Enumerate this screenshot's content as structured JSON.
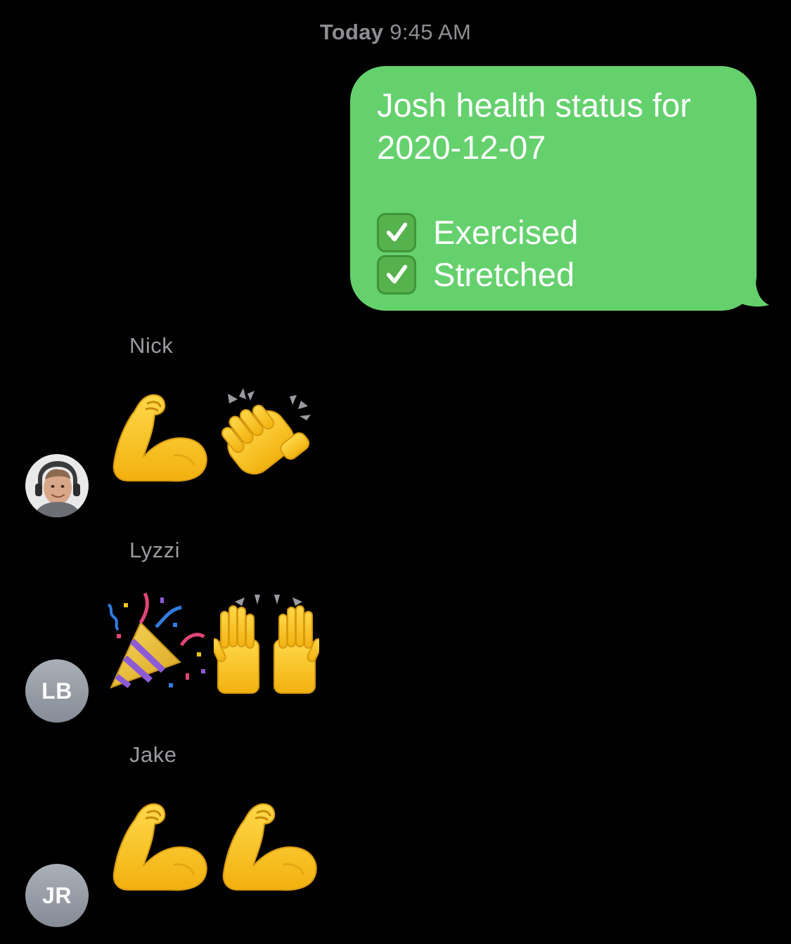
{
  "header": {
    "timestamp_day": "Today",
    "timestamp_time": "9:45 AM"
  },
  "colors": {
    "background": "#000000",
    "outgoing_bubble": "#65d16d",
    "sender_name": "#9a9aa0",
    "timestamp": "#8e8e93"
  },
  "outgoing_message": {
    "line1": "Josh health status for",
    "line2": "2020-12-07",
    "items": [
      {
        "icon": "check-mark-button-emoji",
        "label": "Exercised"
      },
      {
        "icon": "check-mark-button-emoji",
        "label": "Stretched"
      }
    ]
  },
  "incoming_messages": [
    {
      "sender": "Nick",
      "avatar_type": "photo",
      "avatar_initials": "",
      "emojis": [
        "flexed-biceps-emoji",
        "clapping-hands-emoji"
      ]
    },
    {
      "sender": "Lyzzi",
      "avatar_type": "initials",
      "avatar_initials": "LB",
      "emojis": [
        "party-popper-emoji",
        "raising-hands-emoji"
      ]
    },
    {
      "sender": "Jake",
      "avatar_type": "initials",
      "avatar_initials": "JR",
      "emojis": [
        "flexed-biceps-emoji",
        "flexed-biceps-emoji"
      ]
    }
  ]
}
